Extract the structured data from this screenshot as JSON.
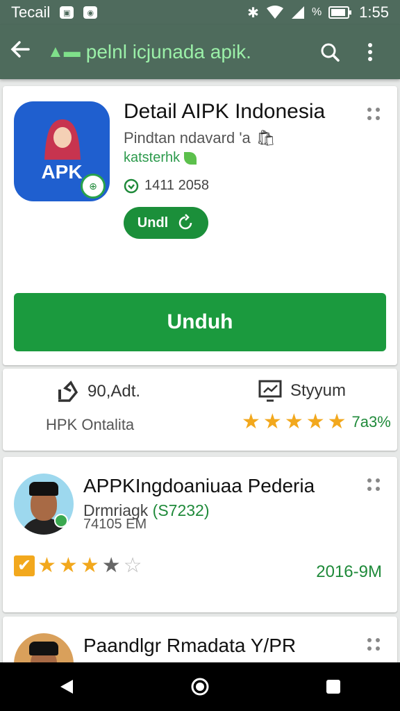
{
  "status_bar": {
    "carrier": "Tecail",
    "time": "1:55",
    "battery": "%"
  },
  "toolbar": {
    "url": "pelnl icjunada apik.",
    "back_icon": "back-arrow-icon",
    "search_icon": "search-icon",
    "menu_icon": "more-vert-icon"
  },
  "app": {
    "icon_label": "APK",
    "title": "Detail AIPK Indonesia",
    "developer": "Pindtan ndavard 'a",
    "category": "katsterhk",
    "downloads": "1411 2058",
    "small_button": "Undl",
    "big_button": "Unduh"
  },
  "stats": {
    "installs": "90,Adt.",
    "installs_sub": "HPK Ontalita",
    "reviews": "Styyum",
    "rating_pct": "7a3%",
    "rating": 5
  },
  "review1": {
    "title": "APPKIngdoaniuaa Pederia",
    "user": "Drmriagk",
    "code": "(S7232)",
    "time": "74105 EM",
    "rating": 3.5,
    "size": "2016-9M"
  },
  "review2": {
    "title": "Paandlgr Rmadata Y/PR"
  },
  "colors": {
    "toolbar": "#4e6b5c",
    "accent_green": "#1b9a3e",
    "star": "#f2a81d",
    "app_icon_bg": "#1f5fcf"
  }
}
